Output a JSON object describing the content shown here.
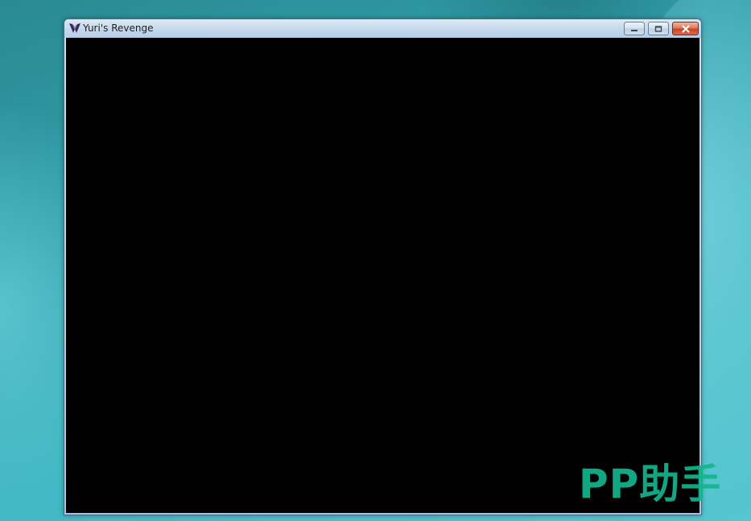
{
  "window": {
    "title": "Yuri's Revenge",
    "app_icon": "yuri-logo-icon",
    "controls": {
      "minimize_icon": "minimize-icon",
      "maximize_icon": "maximize-icon",
      "close_icon": "close-icon"
    }
  },
  "client_area": {
    "background": "#000000"
  },
  "watermark": {
    "text": "PP助手",
    "color": "#14b58e"
  },
  "colors": {
    "desktop": "#2f9ba6",
    "titlebar": "#c4d8ec",
    "close_button": "#c9442a"
  }
}
